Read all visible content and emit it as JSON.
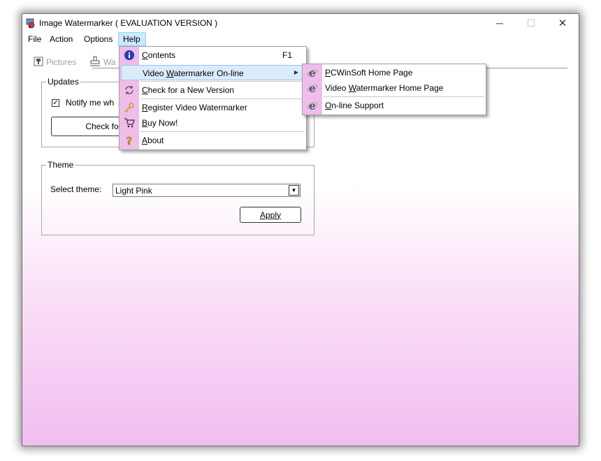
{
  "window": {
    "title": "Image Watermarker ( EVALUATION VERSION )",
    "controls": {
      "minimize": "─",
      "maximize": "☐",
      "close": "✕"
    }
  },
  "menubar": {
    "items": [
      {
        "label": "File"
      },
      {
        "label": "Action"
      },
      {
        "label": "Options"
      },
      {
        "label": "Help",
        "active": true
      }
    ]
  },
  "tabs": [
    {
      "label": "Pictures",
      "icon": "picture-icon"
    },
    {
      "label": "Wa",
      "icon": "stamp-icon"
    }
  ],
  "updates": {
    "title": "Updates",
    "notify_checked": true,
    "notify_label": "Notify me wh",
    "check_button": "Check for"
  },
  "theme": {
    "title": "Theme",
    "select_label": "Select theme:",
    "selected": "Light Pink",
    "apply_button": "Apply"
  },
  "help_menu": {
    "items": [
      {
        "pre": "",
        "key": "C",
        "post": "ontents",
        "shortcut": "F1",
        "icon": "info-icon"
      },
      {
        "pre": "Video ",
        "key": "W",
        "post": "atermarker On-line",
        "submenu": true,
        "highlighted": true
      },
      {
        "pre": "",
        "key": "C",
        "post": "heck for a New Version",
        "icon": "refresh-icon"
      },
      {
        "pre": "",
        "key": "R",
        "post": "egister Video Watermarker",
        "icon": "key-icon"
      },
      {
        "pre": "",
        "key": "B",
        "post": "uy Now!",
        "icon": "cart-icon"
      },
      {
        "pre": "",
        "key": "A",
        "post": "bout",
        "icon": "question-icon"
      }
    ]
  },
  "online_submenu": {
    "items": [
      {
        "pre": "",
        "key": "P",
        "post": "CWinSoft Home Page",
        "icon": "ie-icon"
      },
      {
        "pre": "Video ",
        "key": "W",
        "post": "atermarker Home Page",
        "icon": "ie-icon"
      },
      {
        "pre": "",
        "key": "O",
        "post": "n-line Support",
        "icon": "ie-icon"
      }
    ]
  },
  "colors": {
    "gradient_bottom": "#f1bdf0",
    "menu_gutter": "#f0bdea",
    "menu_highlight": "#dcebfc",
    "menubar_active": "#cce8ff"
  }
}
